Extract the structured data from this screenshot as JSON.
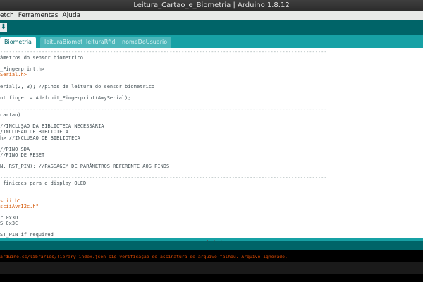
{
  "window": {
    "title": "Leitura_Cartao_e_Biometria | Arduino 1.8.12"
  },
  "menubar": {
    "items": [
      "etch",
      "Ferramentas",
      "Ajuda"
    ]
  },
  "toolbar": {
    "button_icon": "upload-icon",
    "button_glyph": "⬇"
  },
  "tabs": [
    {
      "label": "Biometria",
      "active": true
    },
    {
      "label": "leituraBiometrica",
      "active": false
    },
    {
      "label": "leituraRfid",
      "active": false
    },
    {
      "label": "nomeDoUsuario",
      "active": false
    }
  ],
  "code_lines": [
    {
      "text": "--------------------------------------------------------------------------------------------------------------",
      "kind": "sep"
    },
    {
      "text": "âmetros do sensor biometrico",
      "kind": "comment"
    },
    {
      "text": "",
      "kind": "plain"
    },
    {
      "text": "_Fingerprint.h>",
      "kind": "plain"
    },
    {
      "text": "Serial.h>",
      "kind": "orange"
    },
    {
      "text": "",
      "kind": "plain"
    },
    {
      "text": "erial(2, 3); //pinos de leitura do sensor biometrico",
      "kind": "plain"
    },
    {
      "text": "",
      "kind": "plain"
    },
    {
      "text": "nt finger = Adafruit_Fingerprint(&mySerial);",
      "kind": "plain"
    },
    {
      "text": "",
      "kind": "plain"
    },
    {
      "text": "--------------------------------------------------------------------------------------------------------------",
      "kind": "sep"
    },
    {
      "text": "cartao)",
      "kind": "comment"
    },
    {
      "text": "",
      "kind": "plain"
    },
    {
      "text": "//INCLUSÃO DA BIBLIOTECA NECESSÁRIA",
      "kind": "comment"
    },
    {
      "text": "/INCLUSÃO DE BIBLIOTECA",
      "kind": "comment"
    },
    {
      "text": "h> //INCLUSÃO DE BIBLIOTECA",
      "kind": "comment"
    },
    {
      "text": "",
      "kind": "plain"
    },
    {
      "text": "//PINO SDA",
      "kind": "comment"
    },
    {
      "text": "//PINO DE RESET",
      "kind": "comment"
    },
    {
      "text": "",
      "kind": "plain"
    },
    {
      "text": "N, RST_PIN); //PASSAGEM DE PARÂMETROS REFERENTE AOS PINOS",
      "kind": "plain"
    },
    {
      "text": "",
      "kind": "plain"
    },
    {
      "text": "--------------------------------------------------------------------------------------------------------------",
      "kind": "sep"
    },
    {
      "text": " finicoes para o display OLED",
      "kind": "comment"
    },
    {
      "text": "",
      "kind": "plain"
    },
    {
      "text": "",
      "kind": "plain"
    },
    {
      "text": "scii.h\"",
      "kind": "orange"
    },
    {
      "text": "sciiAvrI2c.h\"",
      "kind": "orange"
    },
    {
      "text": "",
      "kind": "plain"
    },
    {
      "text": "r 0x3D",
      "kind": "plain"
    },
    {
      "text": "S 0x3C",
      "kind": "plain"
    },
    {
      "text": "",
      "kind": "plain"
    },
    {
      "text": "ST_PIN if required",
      "kind": "plain"
    }
  ],
  "console": {
    "message": "arduino.cc/libraries/library_index.json sig verificação de assinatura de arquivo falhou. Arquivo ignorado."
  },
  "colors": {
    "toolbar": "#006468",
    "tabbar": "#17a1a5",
    "console_text": "#e34c00"
  }
}
